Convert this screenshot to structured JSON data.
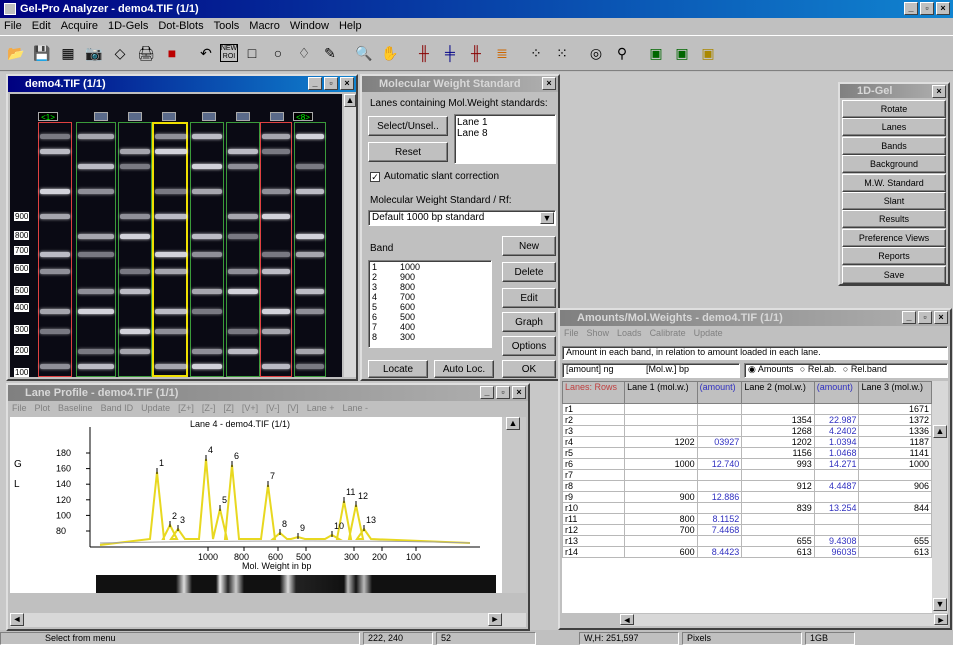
{
  "app": {
    "title": "Gel-Pro Analyzer - demo4.TIF (1/1)",
    "menu": [
      "File",
      "Edit",
      "Acquire",
      "1D-Gels",
      "Dot-Blots",
      "Tools",
      "Macro",
      "Window",
      "Help"
    ]
  },
  "toolbar": {
    "icons": [
      "open-icon",
      "save-icon",
      "grid-icon",
      "camera-icon",
      "shape-icon",
      "print-icon",
      "book-icon",
      "undo-icon",
      "new-roi-icon",
      "rectangle-icon",
      "ellipse-icon",
      "polygon-icon",
      "pencil-icon",
      "zoom-icon",
      "hand-icon",
      "lanes-icon",
      "bands-icon",
      "lanes2-icon",
      "color-bars-icon",
      "dotblot-icon",
      "dotblot2-icon",
      "globe-icon",
      "branch-icon",
      "image-icon",
      "image2-icon",
      "image3-icon"
    ],
    "new_roi": "NEW ROI"
  },
  "gel_window": {
    "title": "demo4.TIF (1/1)",
    "lane_first": "<1>",
    "lane_last": "<8>",
    "mw_labels": [
      "900",
      "800",
      "700",
      "600",
      "500",
      "400",
      "300",
      "200",
      "100"
    ]
  },
  "mw_dialog": {
    "title": "Molecular Weight Standard",
    "lanes_label": "Lanes containing Mol.Weight standards:",
    "select_btn": "Select/Unsel..",
    "reset_btn": "Reset",
    "lanes": [
      "Lane 1",
      "Lane 8"
    ],
    "slant_label": "Automatic slant correction",
    "standard_label": "Molecular Weight Standard / Rf:",
    "standard_value": "Default 1000 bp standard",
    "band_label": "Band",
    "bands": [
      [
        "1",
        "1000"
      ],
      [
        "2",
        "900"
      ],
      [
        "3",
        "800"
      ],
      [
        "4",
        "700"
      ],
      [
        "5",
        "600"
      ],
      [
        "6",
        "500"
      ],
      [
        "7",
        "400"
      ],
      [
        "8",
        "300"
      ]
    ],
    "new_btn": "New",
    "delete_btn": "Delete",
    "edit_btn": "Edit",
    "graph_btn": "Graph",
    "options_btn": "Options",
    "locate_btn": "Locate",
    "autoloc_btn": "Auto Loc.",
    "ok_btn": "OK"
  },
  "gel1d": {
    "title": "1D-Gel",
    "buttons": [
      "Rotate",
      "Lanes",
      "Bands",
      "Background",
      "M.W. Standard",
      "Slant",
      "Results",
      "Preference Views",
      "Reports",
      "Save"
    ]
  },
  "profile": {
    "title": "Lane Profile - demo4.TIF (1/1)",
    "menu": [
      "File",
      "Plot",
      "Baseline",
      "Band ID",
      "Update",
      "[Z+]",
      "[Z-]",
      "[Z]",
      "[V+]",
      "[V-]",
      "[V]",
      "Lane +",
      "Lane -"
    ],
    "plot_title": "Lane 4 - demo4.TIF (1/1)",
    "y_ticks": [
      "180",
      "160",
      "140",
      "120",
      "100",
      "80"
    ],
    "x_ticks": [
      "1000",
      "800",
      "600",
      "500",
      "300",
      "200",
      "100"
    ],
    "xlabel": "Mol. Weight in bp",
    "side": [
      "G",
      "L"
    ],
    "peaks": [
      "1",
      "2",
      "3",
      "4",
      "5",
      "6",
      "7",
      "8",
      "9",
      "10",
      "11",
      "12",
      "13"
    ]
  },
  "amounts": {
    "title": "Amounts/Mol.Weights - demo4.TIF (1/1)",
    "menu": [
      "File",
      "Show",
      "Loads",
      "Calibrate",
      "Update"
    ],
    "info": "Amount in each band, in relation to amount loaded in each lane.",
    "unit_label": "[amount]  ng",
    "unit2": "[Mol.w.]  bp",
    "radio": [
      "Amounts",
      "Rel.ab.",
      "Rel.band"
    ],
    "headers": [
      "Lanes: Rows",
      "Lane 1 (mol.w.)",
      "(amount)",
      "Lane 2 (mol.w.)",
      "(amount)",
      "Lane 3 (mol.w.)"
    ],
    "rows": [
      [
        "r1",
        "",
        "",
        "",
        "",
        "1671"
      ],
      [
        "r2",
        "",
        "",
        "1354",
        "22.987",
        "1372"
      ],
      [
        "r3",
        "",
        "",
        "1268",
        "4.2402",
        "1336"
      ],
      [
        "r4",
        "1202",
        "03927",
        "1202",
        "1.0394",
        "1187"
      ],
      [
        "r5",
        "",
        "",
        "1156",
        "1.0468",
        "1141"
      ],
      [
        "r6",
        "1000",
        "12.740",
        "993",
        "14.271",
        "1000"
      ],
      [
        "r7",
        "",
        "",
        "",
        "",
        ""
      ],
      [
        "r8",
        "",
        "",
        "912",
        "4.4487",
        "906"
      ],
      [
        "r9",
        "900",
        "12.886",
        "",
        "",
        ""
      ],
      [
        "r10",
        "",
        "",
        "839",
        "13.254",
        "844"
      ],
      [
        "r11",
        "800",
        "8.1152",
        "",
        "",
        ""
      ],
      [
        "r12",
        "700",
        "7.4468",
        "",
        "",
        ""
      ],
      [
        "r13",
        "",
        "",
        "655",
        "9.4308",
        "655"
      ],
      [
        "r14",
        "600",
        "8.4423",
        "613",
        "96035",
        "613"
      ]
    ]
  },
  "status": {
    "msg": "Select from menu",
    "coords": "222, 240",
    "val": "52",
    "wh": "W,H: 251,597",
    "unit": "Pixels",
    "size": "1GB"
  }
}
